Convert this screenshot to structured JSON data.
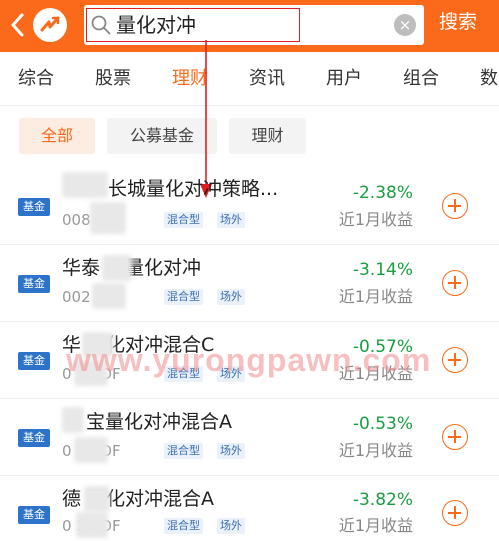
{
  "header": {
    "search_value": "量化对冲",
    "search_button": "搜索"
  },
  "tabs": [
    {
      "label": "综合"
    },
    {
      "label": "股票"
    },
    {
      "label": "理财",
      "active": true
    },
    {
      "label": "资讯"
    },
    {
      "label": "用户"
    },
    {
      "label": "组合"
    },
    {
      "label": "数"
    }
  ],
  "filters": [
    {
      "label": "全部",
      "active": true
    },
    {
      "label": "公募基金"
    },
    {
      "label": "理财"
    }
  ],
  "rows": [
    {
      "badge": "基金",
      "name": "长城量化对冲策略...",
      "code": "008  OF",
      "tags": [
        "混合型",
        "场外"
      ],
      "pct": "-2.38%",
      "pct_label": "近1月收益"
    },
    {
      "badge": "基金",
      "name": "华泰  瑞量化对冲",
      "code": "002  OF",
      "tags": [
        "混合型",
        "场外"
      ],
      "pct": "-3.14%",
      "pct_label": "近1月收益"
    },
    {
      "badge": "基金",
      "name": "华  量化对冲混合C",
      "code": "0  54.OF",
      "tags": [
        "混合型",
        "场外"
      ],
      "pct": "-0.57%",
      "pct_label": "近1月收益"
    },
    {
      "badge": "基金",
      "name": "宝量化对冲混合A",
      "code": "0  53.OF",
      "tags": [
        "混合型",
        "场外"
      ],
      "pct": "-0.53%",
      "pct_label": "近1月收益"
    },
    {
      "badge": "基金",
      "name": "德  量化对冲混合A",
      "code": "0  38.OF",
      "tags": [
        "混合型",
        "场外"
      ],
      "pct": "-3.82%",
      "pct_label": "近1月收益"
    }
  ],
  "watermark": "www.yurongpawn.com",
  "colors": {
    "accent": "#fa6a1a",
    "negative": "#1a9d3f",
    "badge": "#2c73c9"
  }
}
